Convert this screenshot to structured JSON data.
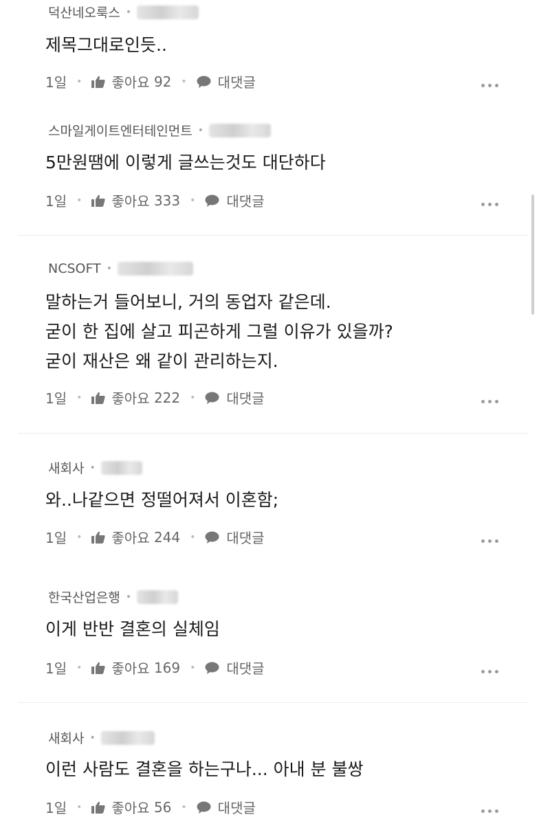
{
  "labels": {
    "like": "좋아요",
    "reply": "대댓글"
  },
  "comments": [
    {
      "author": "덕산네오룩스",
      "text": [
        "제목그대로인듯.."
      ],
      "time": "1일",
      "likes": "92"
    },
    {
      "author": "스마일게이트엔터테인먼트",
      "text": [
        "5만원땜에 이렇게 글쓰는것도 대단하다"
      ],
      "time": "1일",
      "likes": "333"
    },
    {
      "author": "NCSOFT",
      "text": [
        "말하는거 들어보니, 거의 동업자 같은데.",
        "굳이 한 집에 살고 피곤하게 그럴 이유가 있을까?",
        "굳이 재산은 왜 같이 관리하는지."
      ],
      "time": "1일",
      "likes": "222"
    },
    {
      "author": "새회사",
      "text": [
        "와..나같으면 정떨어져서 이혼함;"
      ],
      "time": "1일",
      "likes": "244"
    },
    {
      "author": "한국산업은행",
      "text": [
        "이게 반반 결혼의 실체임"
      ],
      "time": "1일",
      "likes": "169"
    },
    {
      "author": "새회사",
      "text": [
        "이런 사람도 결혼을 하는구나... 아내 분 불쌍"
      ],
      "time": "1일",
      "likes": "56"
    }
  ],
  "icons": {
    "like": "thumbs-up-icon",
    "reply": "speech-bubble-icon",
    "more": "more-dots-icon"
  },
  "colors": {
    "text": "#1a1a1a",
    "meta": "#555555",
    "icon": "#777777"
  }
}
